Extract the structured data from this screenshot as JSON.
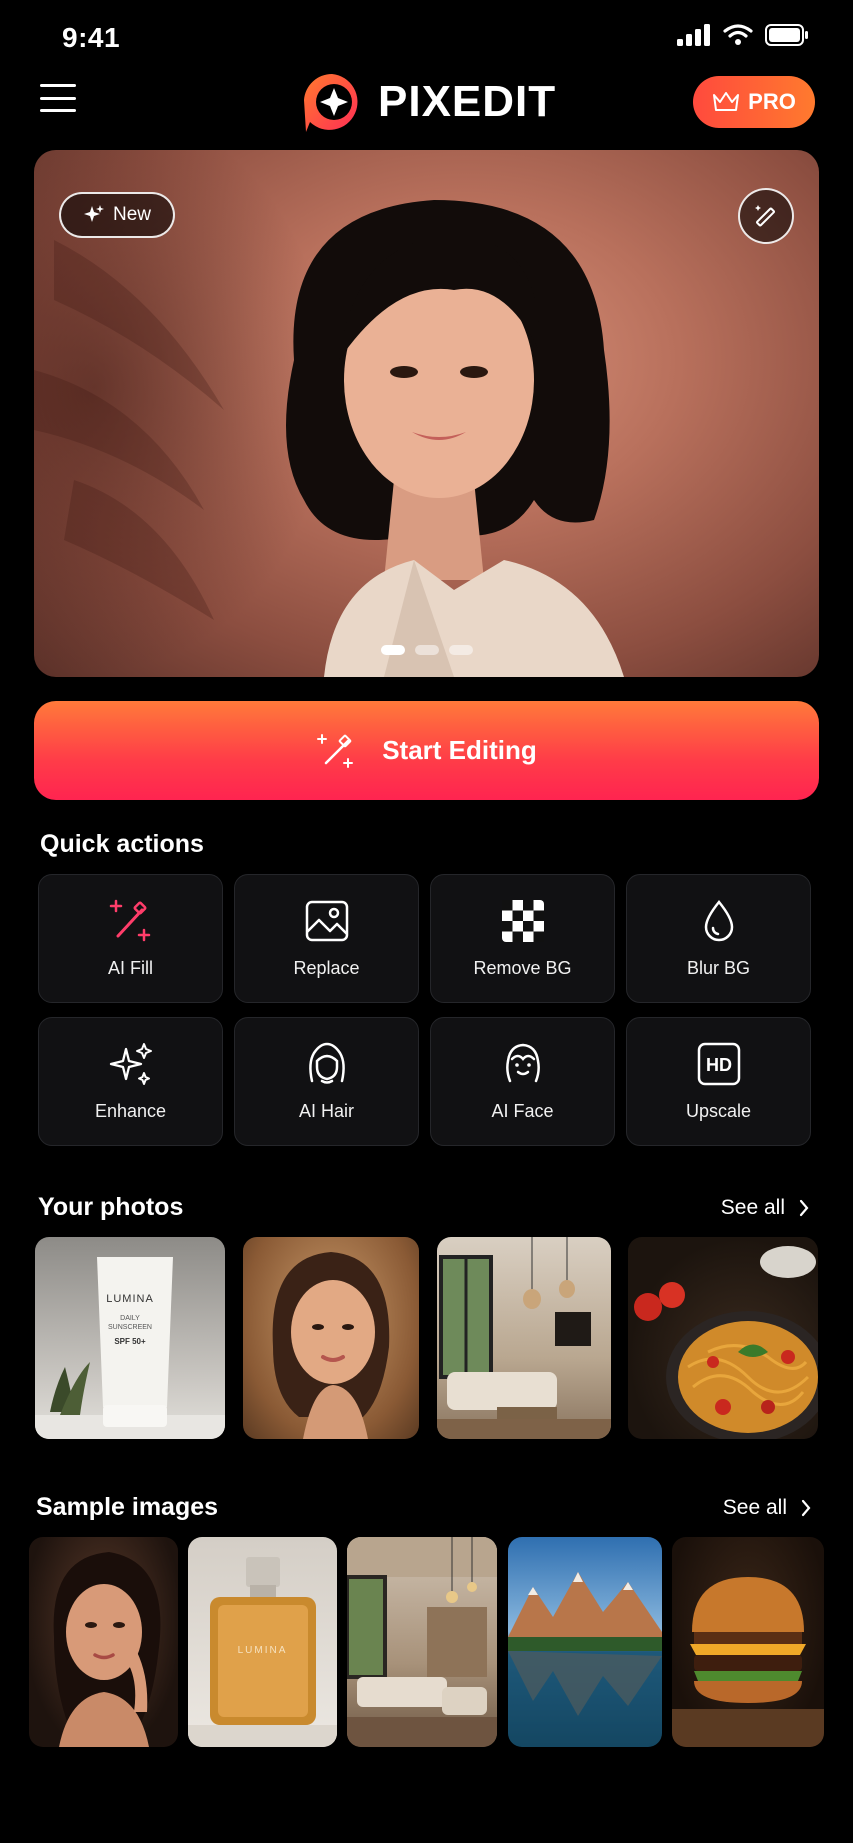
{
  "status_bar": {
    "time": "9:41"
  },
  "header": {
    "brand_name": "PIXEDIT",
    "pro_label": "PRO"
  },
  "hero": {
    "badge_label": "New",
    "active_slide": 1,
    "slide_count": 3
  },
  "start_button": {
    "label": "Start Editing"
  },
  "quick_actions": {
    "title": "Quick actions",
    "items": [
      {
        "label": "AI Fill",
        "icon": "ai-fill-wand-icon"
      },
      {
        "label": "Replace",
        "icon": "image-icon"
      },
      {
        "label": "Remove BG",
        "icon": "checkerboard-icon"
      },
      {
        "label": "Blur BG",
        "icon": "droplet-icon"
      },
      {
        "label": "Enhance",
        "icon": "sparkles-icon"
      },
      {
        "label": "AI Hair",
        "icon": "hair-icon"
      },
      {
        "label": "AI Face",
        "icon": "face-icon"
      },
      {
        "label": "Upscale",
        "icon": "hd-icon"
      }
    ]
  },
  "your_photos": {
    "title": "Your photos",
    "see_all": "See all",
    "product_text": {
      "brand": "LUMINA",
      "line1": "DAILY",
      "line2": "SUNSCREEN",
      "line3": "SPF 50+"
    }
  },
  "sample_images": {
    "title": "Sample images",
    "see_all": "See all",
    "perfume_text": "LUMINA"
  },
  "colors": {
    "accent": "#ff3c48",
    "accent_orange": "#ff7a2e",
    "ai_fill_icon": "#ff3d6a"
  }
}
